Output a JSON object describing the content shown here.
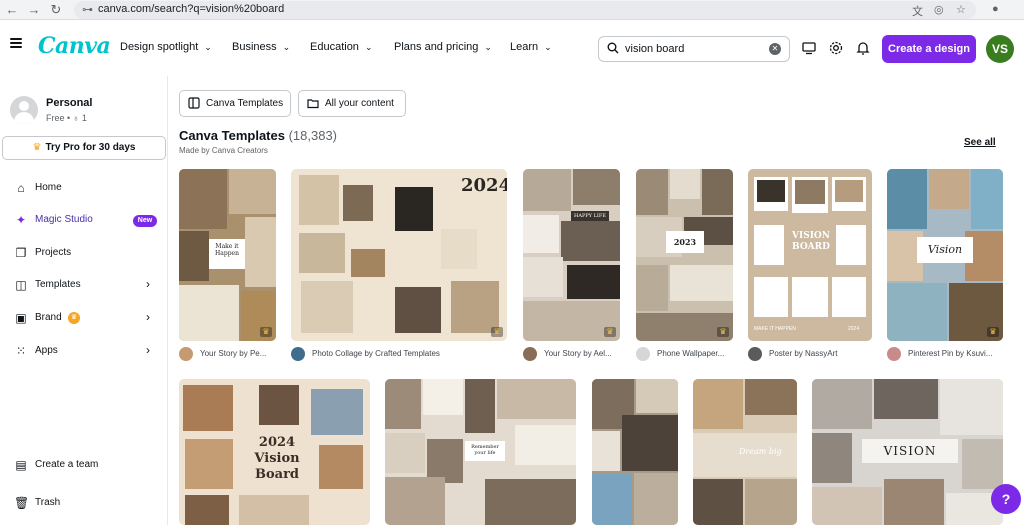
{
  "browser": {
    "url": "canva.com/search?q=vision%20board"
  },
  "topnav": {
    "logo": "Canva",
    "menu": [
      {
        "label": "Design spotlight"
      },
      {
        "label": "Business"
      },
      {
        "label": "Education"
      },
      {
        "label": "Plans and pricing"
      },
      {
        "label": "Learn"
      }
    ],
    "search_value": "vision board",
    "create_label": "Create a design",
    "avatar_initials": "VS"
  },
  "sidebar": {
    "account_name": "Personal",
    "account_plan": "Free • ♁ 1",
    "try_pro": "Try Pro for 30 days",
    "items": [
      {
        "label": "Home",
        "icon": "home-icon"
      },
      {
        "label": "Magic Studio",
        "icon": "sparkle-icon",
        "badge": "New"
      },
      {
        "label": "Projects",
        "icon": "folder-icon"
      },
      {
        "label": "Templates",
        "icon": "templates-icon"
      },
      {
        "label": "Brand",
        "icon": "brand-icon"
      },
      {
        "label": "Apps",
        "icon": "apps-icon"
      }
    ],
    "bottom_items": [
      {
        "label": "Create a team",
        "icon": "team-icon"
      },
      {
        "label": "Trash",
        "icon": "trash-icon"
      }
    ]
  },
  "main": {
    "tabs": [
      {
        "label": "Canva Templates"
      },
      {
        "label": "All your content"
      }
    ],
    "section_title": "Canva Templates",
    "section_count": "(18,383)",
    "section_subtitle": "Made by Canva Creators",
    "see_all": "See all",
    "row1": [
      {
        "caption": "Your Story by Pe...",
        "overlay": "Make it Happen"
      },
      {
        "caption": "Photo Collage by Crafted Templates",
        "overlay": "2024"
      },
      {
        "caption": "Your Story by Ael...",
        "overlay": "HAPPY LIFE"
      },
      {
        "caption": "Phone Wallpaper...",
        "overlay": "2023"
      },
      {
        "caption": "Poster by NassyArt",
        "overlay": "VISION BOARD",
        "footer_left": "MAKE IT HAPPEN",
        "footer_right": "2024"
      },
      {
        "caption": "Pinterest Pin by Ksuvi...",
        "overlay": "Vision"
      }
    ],
    "row2": [
      {
        "overlay": "2024 Vision Board"
      },
      {
        "overlay": "Remember your life"
      },
      {
        "overlay": ""
      },
      {
        "overlay": "Dream big"
      },
      {
        "overlay": "VISION"
      }
    ]
  },
  "help_label": "?",
  "colors": {
    "brand_purple": "#7d2ae8",
    "logo_teal": "#00c4cc",
    "avatar_green": "#3a7d21"
  }
}
